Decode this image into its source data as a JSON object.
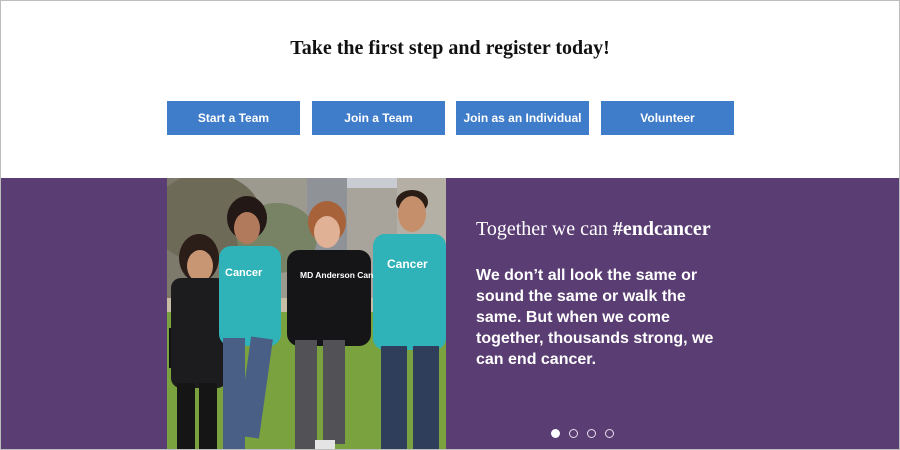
{
  "hero": {
    "headline": "Take the first step and register today!"
  },
  "actions": {
    "start_team": "Start a Team",
    "join_team": "Join a Team",
    "join_individual": "Join as an Individual",
    "volunteer": "Volunteer"
  },
  "slide": {
    "tagline_prefix": "Together we can",
    "tagline_hashtag": "#endcancer",
    "body": "We don’t all look the same or sound the same or walk the same. But when we come together, thousands strong, we can end cancer.",
    "shirt_text_1": "Cancer",
    "shirt_text_2": "MD Anderson Cancer Center",
    "shirt_text_3": "Cancer"
  },
  "carousel": {
    "total_slides": 4,
    "active_slide": 1
  },
  "colors": {
    "button_blue": "#3f7cc9",
    "band_purple": "#5a3d73",
    "shirt_teal": "#2fb2b8"
  }
}
